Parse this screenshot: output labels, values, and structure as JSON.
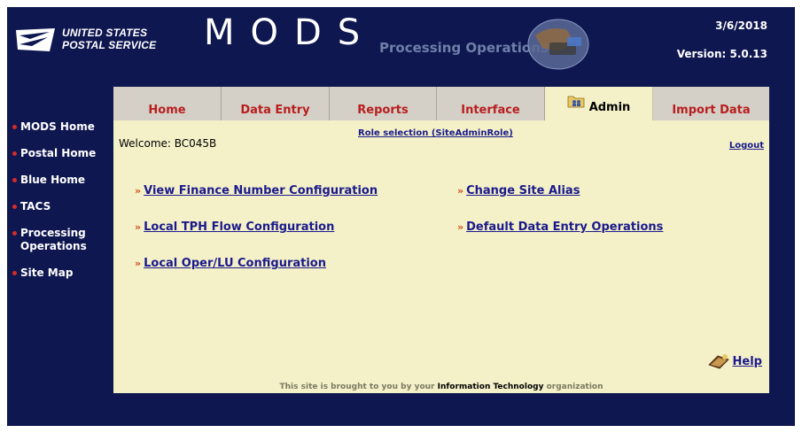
{
  "header": {
    "org_line1": "UNITED STATES",
    "org_line2": "POSTAL SERVICE",
    "app_title": "MODS",
    "subtitle": "Processing Operations",
    "date": "3/6/2018",
    "version": "Version: 5.0.13"
  },
  "left_nav": [
    {
      "label": "MODS Home"
    },
    {
      "label": "Postal Home"
    },
    {
      "label": "Blue Home"
    },
    {
      "label": "TACS"
    },
    {
      "label": "Processing Operations"
    },
    {
      "label": "Site Map"
    }
  ],
  "tabs": [
    {
      "label": "Home",
      "active": false
    },
    {
      "label": "Data Entry",
      "active": false
    },
    {
      "label": "Reports",
      "active": false
    },
    {
      "label": "Interface",
      "active": false
    },
    {
      "label": "Admin",
      "active": true,
      "icon": "folder-users-icon"
    },
    {
      "label": "Import Data",
      "active": false
    }
  ],
  "content": {
    "welcome": "Welcome: BC045B",
    "role_selection": "Role selection (SiteAdminRole)",
    "logout": "Logout",
    "links_left": [
      "View Finance Number Configuration",
      "Local TPH Flow Configuration",
      "Local Oper/LU Configuration"
    ],
    "links_right": [
      "Change Site Alias",
      "Default Data Entry Operations"
    ],
    "link_marker": "»",
    "help": "Help",
    "footer_prefix": "This site is brought to you by your",
    "footer_bold": "Information Technology",
    "footer_suffix": "organization"
  },
  "colors": {
    "background": "#0f1750",
    "panel": "#f4f0c8",
    "tab_inactive": "#d4d0c8",
    "tab_text": "#b81e1e",
    "link": "#1a1a8c",
    "bullet": "#d62b2b"
  }
}
